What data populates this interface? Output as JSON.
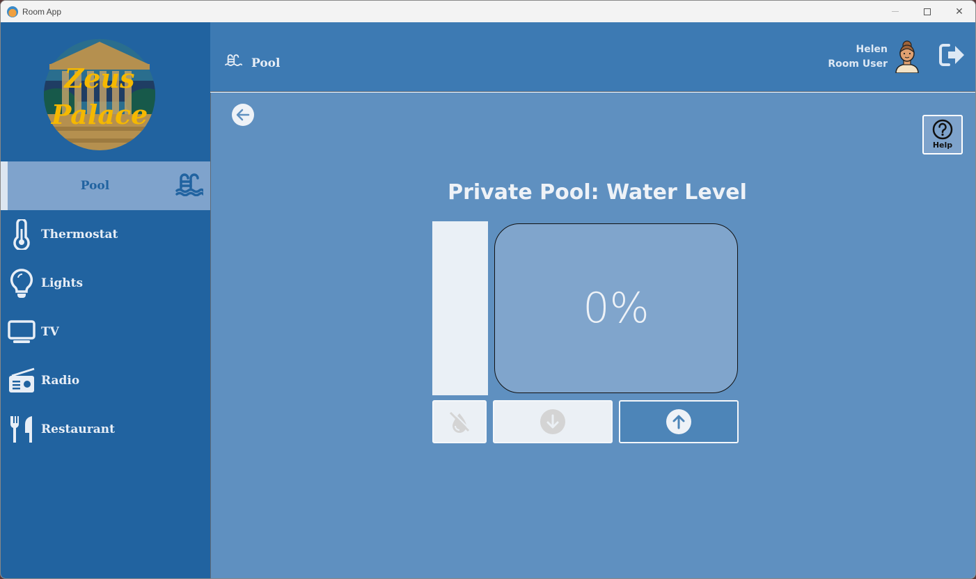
{
  "window": {
    "title": "Room App",
    "controls": [
      "minimize",
      "maximize",
      "close"
    ]
  },
  "sidebar": {
    "logo": {
      "line1": "Zeus",
      "line2": "Palace"
    },
    "items": [
      {
        "label": "Pool",
        "icon": "pool-icon",
        "active": true
      },
      {
        "label": "Thermostat",
        "icon": "thermometer-icon",
        "active": false
      },
      {
        "label": "Lights",
        "icon": "lightbulb-icon",
        "active": false
      },
      {
        "label": "TV",
        "icon": "tv-icon",
        "active": false
      },
      {
        "label": "Radio",
        "icon": "radio-icon",
        "active": false
      },
      {
        "label": "Restaurant",
        "icon": "utensils-icon",
        "active": false
      }
    ]
  },
  "header": {
    "page_title": "Pool",
    "user": {
      "name": "Helen",
      "role": "Room User"
    }
  },
  "main": {
    "help_label": "Help",
    "panel_title": "Private Pool: Water Level",
    "water_level_percent": 0,
    "water_level_display": "0%",
    "buttons": {
      "drain": {
        "icon": "water-off-icon",
        "enabled": false
      },
      "decrease": {
        "icon": "arrow-down-circle-icon",
        "enabled": false
      },
      "increase": {
        "icon": "arrow-up-circle-icon",
        "enabled": true
      }
    }
  },
  "colors": {
    "sidebar_bg": "#2163a0",
    "header_bg": "#3d7ab3",
    "main_bg": "#5f90c0",
    "active_item_bg": "#7fa3cc",
    "text_light": "#e8eef6"
  }
}
